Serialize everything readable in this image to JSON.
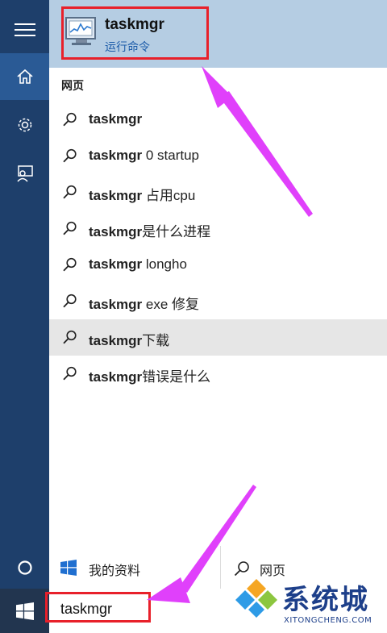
{
  "best_match": {
    "title": "taskmgr",
    "subtitle": "运行命令"
  },
  "section_label": "网页",
  "suggestions": [
    {
      "bold": "taskmgr",
      "rest": ""
    },
    {
      "bold": "taskmgr",
      "rest": " 0 startup"
    },
    {
      "bold": "taskmgr",
      "rest": " 占用cpu"
    },
    {
      "bold": "taskmgr",
      "rest": "是什么进程"
    },
    {
      "bold": "taskmgr",
      "rest": " longho"
    },
    {
      "bold": "taskmgr",
      "rest": " exe 修复"
    },
    {
      "bold": "taskmgr",
      "rest": "下载"
    },
    {
      "bold": "taskmgr",
      "rest": "错误是什么"
    }
  ],
  "tabs": {
    "my_stuff": "我的资料",
    "web": "网页"
  },
  "search": {
    "value": "taskmgr"
  },
  "watermark": {
    "cn": "系统城",
    "en": "XITONGCHENG.COM"
  },
  "colors": {
    "sidebar": "#1e3f6b",
    "accent": "#1a5aa8",
    "highlight_box": "#e8202a",
    "arrow": "#e040fb"
  },
  "icons": [
    "hamburger-icon",
    "home-icon",
    "gear-icon",
    "feedback-icon",
    "cortana-icon",
    "windows-icon",
    "search-icon",
    "monitor-icon"
  ]
}
